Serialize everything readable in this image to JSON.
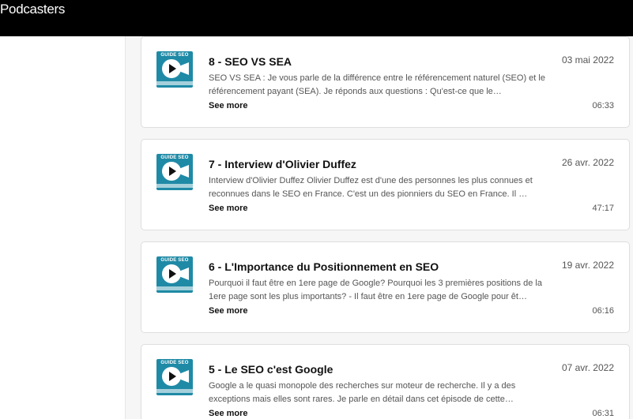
{
  "header": {
    "brand": "Podcasters"
  },
  "episodes": [
    {
      "thumb_tag": "GUIDE SEO",
      "title": "8 - SEO VS SEA",
      "date": "03 mai 2022",
      "description": "SEO VS SEA : Je vous parle de la différence entre le référencement naturel (SEO) et le référencement payant (SEA). Je réponds aux questions : Qu'est-ce que le…",
      "see_more": "See more",
      "duration": "06:33"
    },
    {
      "thumb_tag": "GUIDE SEO",
      "title": "7 - Interview d'Olivier Duffez",
      "date": "26 avr. 2022",
      "description": "Interview d'Olivier Duffez Olivier Duffez est d'une des personnes les plus connues et reconnues dans le SEO en France. C'est un des pionniers du SEO en France. Il …",
      "see_more": "See more",
      "duration": "47:17"
    },
    {
      "thumb_tag": "GUIDE SEO",
      "title": "6 - L'Importance du Positionnement en SEO",
      "date": "19 avr. 2022",
      "description": "Pourquoi il faut être en 1ere page de Google? Pourquoi les 3 premières positions de la 1ere page sont les plus importants?  - Il faut être en 1ere page de Google pour êt…",
      "see_more": "See more",
      "duration": "06:16"
    },
    {
      "thumb_tag": "GUIDE SEO",
      "title": "5 - Le SEO c'est Google",
      "date": "07 avr. 2022",
      "description": "Google a le quasi monopole des recherches sur moteur de recherche. Il y a des exceptions mais elles sont rares. Je parle en détail dans cet épisode de cette…",
      "see_more": "See more",
      "duration": "06:31"
    }
  ]
}
